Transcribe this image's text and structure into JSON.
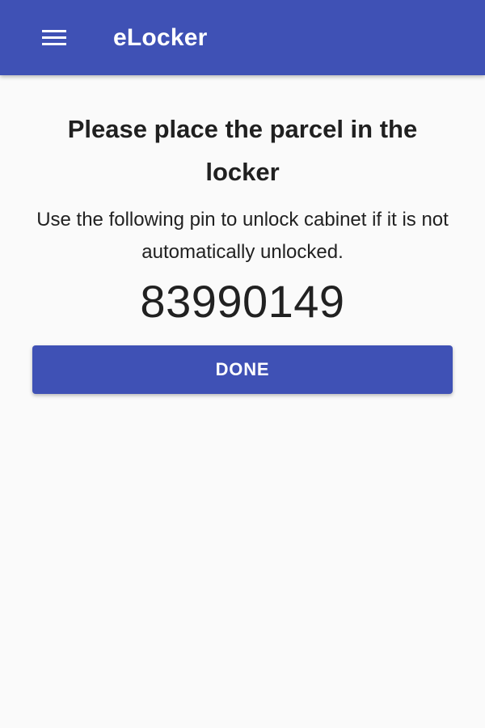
{
  "app_bar": {
    "title": "eLocker",
    "menu_icon": "hamburger-menu-icon",
    "background_color": "#3f51b5"
  },
  "main": {
    "heading": "Please place the parcel in the locker",
    "instructions": "Use the following pin to unlock cabinet if it is not automatically unlocked.",
    "pin": "83990149",
    "done_button_label": "DONE"
  },
  "colors": {
    "accent": "#3f51b5",
    "background": "#fafafa",
    "text": "#212121"
  }
}
